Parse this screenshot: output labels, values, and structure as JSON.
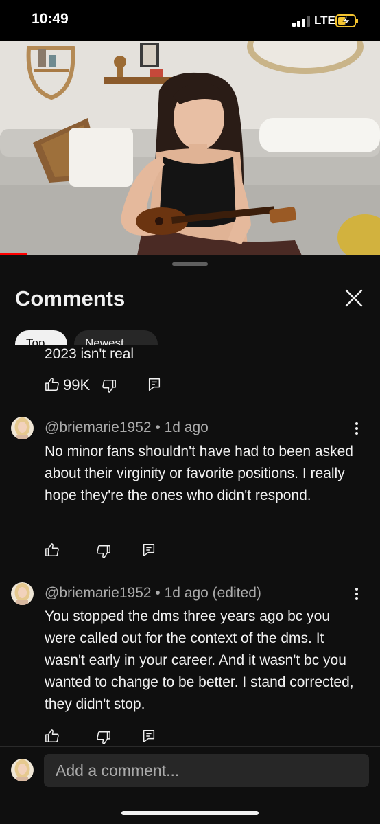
{
  "status_bar": {
    "time": "10:49",
    "network": "LTE",
    "battery": "charging"
  },
  "video": {
    "description_icon": "video-player"
  },
  "sheet": {
    "title": "Comments",
    "tabs": [
      {
        "label": "Top"
      },
      {
        "label": "Newest"
      }
    ]
  },
  "comments": [
    {
      "text": "2023 isn't real",
      "likes": "99K"
    },
    {
      "author": "@briemarie1952",
      "time": "1d ago",
      "text": "No minor fans shouldn't have had to been asked about their virginity or favorite positions. I really hope they're the ones who didn't respond."
    },
    {
      "author": "@briemarie1952",
      "time": "1d ago (edited)",
      "text": "You stopped the dms three years ago bc you were called out for the context of the dms. It wasn't early in your career. And it wasn't bc you wanted to change to be better. I stand corrected, they didn't stop."
    }
  ],
  "composer": {
    "placeholder": "Add a comment..."
  },
  "colors": {
    "background": "#0f0f0f",
    "accent_red": "#ff0000",
    "text_secondary": "#aaaaaa",
    "battery_charging": "#f4c430"
  }
}
